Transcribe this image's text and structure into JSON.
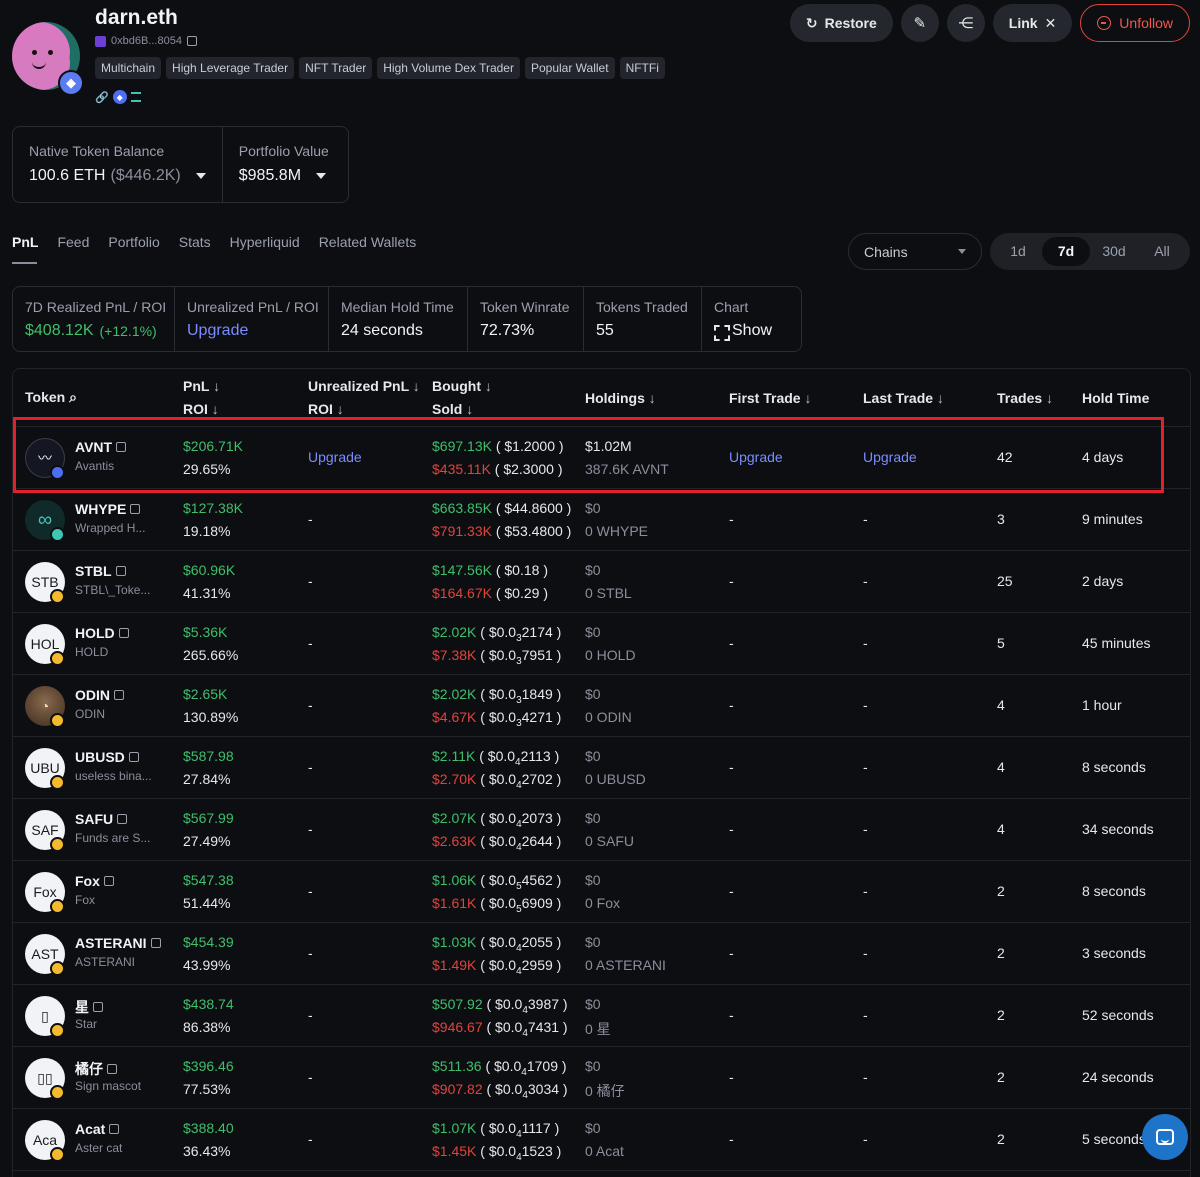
{
  "profile": {
    "name": "darn.eth",
    "address": "0xbd6B...8054",
    "tags": [
      "Multichain",
      "High Leverage Trader",
      "NFT Trader",
      "High Volume Dex Trader",
      "Popular Wallet",
      "NFTFi"
    ]
  },
  "actions": {
    "restore": "Restore",
    "link": "Link",
    "unfollow": "Unfollow"
  },
  "balances": {
    "native_label": "Native Token Balance",
    "native_value": "100.6 ETH",
    "native_usd": "($446.2K)",
    "portfolio_label": "Portfolio Value",
    "portfolio_value": "$985.8M"
  },
  "tabs": [
    "PnL",
    "Feed",
    "Portfolio",
    "Stats",
    "Hyperliquid",
    "Related Wallets"
  ],
  "chains_select": "Chains",
  "periods": [
    "1d",
    "7d",
    "30d",
    "All"
  ],
  "stats": {
    "realized_label": "7D Realized PnL / ROI",
    "realized_value": "$408.12K",
    "realized_roi": "(+12.1%)",
    "unrealized_label": "Unrealized PnL / ROI",
    "unrealized_value": "Upgrade",
    "median_label": "Median Hold Time",
    "median_value": "24 seconds",
    "winrate_label": "Token Winrate",
    "winrate_value": "72.73%",
    "traded_label": "Tokens Traded",
    "traded_value": "55",
    "chart_label": "Chart",
    "chart_value": "Show"
  },
  "table": {
    "headers": {
      "token": "Token",
      "pnl": "PnL",
      "roi": "ROI",
      "unrealized": "Unrealized PnL",
      "unrealized_roi": "ROI",
      "bought": "Bought",
      "sold": "Sold",
      "holdings": "Holdings",
      "first_trade": "First Trade",
      "last_trade": "Last Trade",
      "trades": "Trades",
      "hold_time": "Hold Time"
    },
    "rows": [
      {
        "icon": "",
        "symbol": "AVNT",
        "name": "Avantis",
        "pnl": "$206.71K",
        "roi": "29.65%",
        "unrealized": "Upgrade",
        "bought": "$697.13K",
        "bought_price": "( $1.2000 )",
        "sold": "$435.11K",
        "sold_price": "( $2.3000 )",
        "holdings": "$1.02M",
        "holdings_qty": "387.6K AVNT",
        "first_trade": "Upgrade",
        "last_trade": "Upgrade",
        "trades": "42",
        "hold_time": "4 days"
      },
      {
        "icon": "",
        "symbol": "WHYPE",
        "name": "Wrapped H...",
        "pnl": "$127.38K",
        "roi": "19.18%",
        "unrealized": "-",
        "bought": "$663.85K",
        "bought_price": "( $44.8600 )",
        "sold": "$791.33K",
        "sold_price": "( $53.4800 )",
        "holdings": "$0",
        "holdings_qty": "0 WHYPE",
        "first_trade": "-",
        "last_trade": "-",
        "trades": "3",
        "hold_time": "9 minutes"
      },
      {
        "icon": "STB",
        "symbol": "STBL",
        "name": "STBL\\_Toke...",
        "pnl": "$60.96K",
        "roi": "41.31%",
        "unrealized": "-",
        "bought": "$147.56K",
        "bought_price": "( $0.18 )",
        "sold": "$164.67K",
        "sold_price": "( $0.29 )",
        "holdings": "$0",
        "holdings_qty": "0 STBL",
        "first_trade": "-",
        "last_trade": "-",
        "trades": "25",
        "hold_time": "2 days"
      },
      {
        "icon": "HOL",
        "symbol": "HOLD",
        "name": "HOLD",
        "pnl": "$5.36K",
        "roi": "265.66%",
        "unrealized": "-",
        "bought": "$2.02K",
        "bought_pre": "( $0.0",
        "bought_sub": "3",
        "bought_post": "2174 )",
        "sold": "$7.38K",
        "sold_pre": "( $0.0",
        "sold_sub": "3",
        "sold_post": "7951 )",
        "holdings": "$0",
        "holdings_qty": "0 HOLD",
        "first_trade": "-",
        "last_trade": "-",
        "trades": "5",
        "hold_time": "45 minutes"
      },
      {
        "icon": "",
        "symbol": "ODIN",
        "name": "ODIN",
        "pnl": "$2.65K",
        "roi": "130.89%",
        "unrealized": "-",
        "bought": "$2.02K",
        "bought_pre": "( $0.0",
        "bought_sub": "3",
        "bought_post": "1849 )",
        "sold": "$4.67K",
        "sold_pre": "( $0.0",
        "sold_sub": "3",
        "sold_post": "4271 )",
        "holdings": "$0",
        "holdings_qty": "0 ODIN",
        "first_trade": "-",
        "last_trade": "-",
        "trades": "4",
        "hold_time": "1 hour"
      },
      {
        "icon": "UBU",
        "symbol": "UBUSD",
        "name": "useless bina...",
        "pnl": "$587.98",
        "roi": "27.84%",
        "unrealized": "-",
        "bought": "$2.11K",
        "bought_pre": "( $0.0",
        "bought_sub": "4",
        "bought_post": "2113 )",
        "sold": "$2.70K",
        "sold_pre": "( $0.0",
        "sold_sub": "4",
        "sold_post": "2702 )",
        "holdings": "$0",
        "holdings_qty": "0 UBUSD",
        "first_trade": "-",
        "last_trade": "-",
        "trades": "4",
        "hold_time": "8 seconds"
      },
      {
        "icon": "SAF",
        "symbol": "SAFU",
        "name": "Funds are S...",
        "pnl": "$567.99",
        "roi": "27.49%",
        "unrealized": "-",
        "bought": "$2.07K",
        "bought_pre": "( $0.0",
        "bought_sub": "4",
        "bought_post": "2073 )",
        "sold": "$2.63K",
        "sold_pre": "( $0.0",
        "sold_sub": "4",
        "sold_post": "2644 )",
        "holdings": "$0",
        "holdings_qty": "0 SAFU",
        "first_trade": "-",
        "last_trade": "-",
        "trades": "4",
        "hold_time": "34 seconds"
      },
      {
        "icon": "Fox",
        "symbol": "Fox",
        "name": "Fox",
        "pnl": "$547.38",
        "roi": "51.44%",
        "unrealized": "-",
        "bought": "$1.06K",
        "bought_pre": "( $0.0",
        "bought_sub": "5",
        "bought_post": "4562 )",
        "sold": "$1.61K",
        "sold_pre": "( $0.0",
        "sold_sub": "5",
        "sold_post": "6909 )",
        "holdings": "$0",
        "holdings_qty": "0 Fox",
        "first_trade": "-",
        "last_trade": "-",
        "trades": "2",
        "hold_time": "8 seconds"
      },
      {
        "icon": "AST",
        "symbol": "ASTERANI",
        "name": "ASTERANI",
        "pnl": "$454.39",
        "roi": "43.99%",
        "unrealized": "-",
        "bought": "$1.03K",
        "bought_pre": "( $0.0",
        "bought_sub": "4",
        "bought_post": "2055 )",
        "sold": "$1.49K",
        "sold_pre": "( $0.0",
        "sold_sub": "4",
        "sold_post": "2959 )",
        "holdings": "$0",
        "holdings_qty": "0 ASTERANI",
        "first_trade": "-",
        "last_trade": "-",
        "trades": "2",
        "hold_time": "3 seconds"
      },
      {
        "icon": "▯",
        "symbol": "星",
        "name": "Star",
        "pnl": "$438.74",
        "roi": "86.38%",
        "unrealized": "-",
        "bought": "$507.92",
        "bought_pre": "( $0.0",
        "bought_sub": "4",
        "bought_post": "3987 )",
        "sold": "$946.67",
        "sold_pre": "( $0.0",
        "sold_sub": "4",
        "sold_post": "7431 )",
        "holdings": "$0",
        "holdings_qty": "0 星",
        "first_trade": "-",
        "last_trade": "-",
        "trades": "2",
        "hold_time": "52 seconds"
      },
      {
        "icon": "▯▯",
        "symbol": "橘仔",
        "name": "Sign mascot",
        "pnl": "$396.46",
        "roi": "77.53%",
        "unrealized": "-",
        "bought": "$511.36",
        "bought_pre": "( $0.0",
        "bought_sub": "4",
        "bought_post": "1709 )",
        "sold": "$907.82",
        "sold_pre": "( $0.0",
        "sold_sub": "4",
        "sold_post": "3034 )",
        "holdings": "$0",
        "holdings_qty": "0 橘仔",
        "first_trade": "-",
        "last_trade": "-",
        "trades": "2",
        "hold_time": "24 seconds"
      },
      {
        "icon": "Aca",
        "symbol": "Acat",
        "name": "Aster cat",
        "pnl": "$388.40",
        "roi": "36.43%",
        "unrealized": "-",
        "bought": "$1.07K",
        "bought_pre": "( $0.0",
        "bought_sub": "4",
        "bought_post": "1117 )",
        "sold": "$1.45K",
        "sold_pre": "( $0.0",
        "sold_sub": "4",
        "sold_post": "1523 )",
        "holdings": "$0",
        "holdings_qty": "0 Acat",
        "first_trade": "-",
        "last_trade": "-",
        "trades": "2",
        "hold_time": "5 seconds"
      }
    ]
  }
}
